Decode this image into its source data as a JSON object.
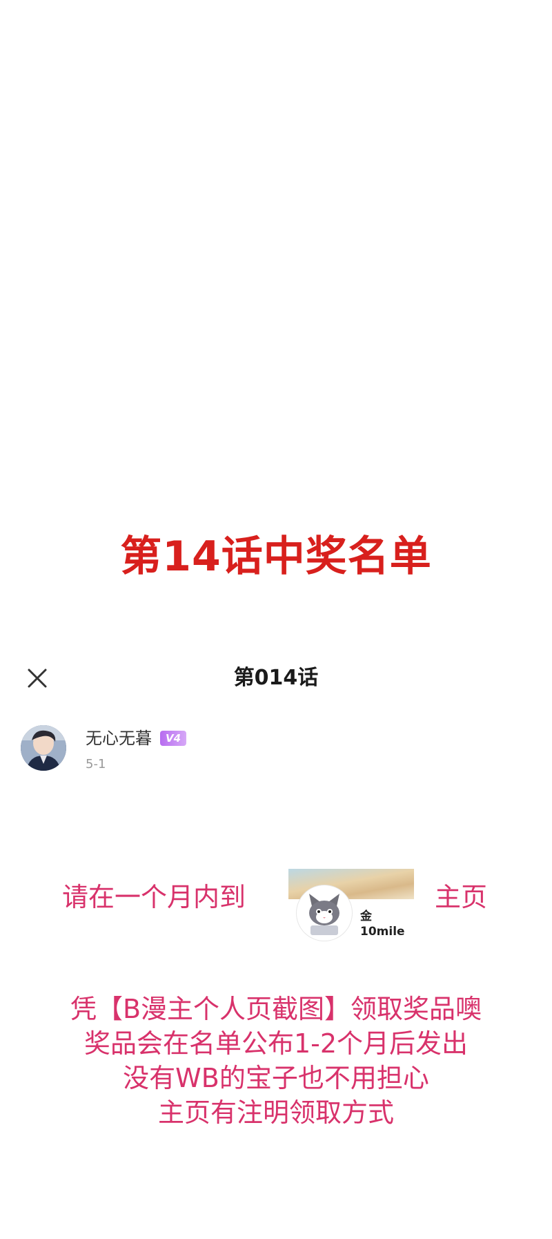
{
  "headline": "第14话中奖名单",
  "nav": {
    "title": "第014话",
    "close_icon": "close-icon"
  },
  "post": {
    "author": "无心无暮",
    "level_badge": "V4",
    "date": "5-1"
  },
  "message": {
    "left_text": "请在一个月内到",
    "right_text": "主页",
    "profile_name": "金10mile"
  },
  "instructions": [
    "凭【B漫主个人页截图】领取奖品噢",
    "奖品会在名单公布1-2个月后发出",
    "没有WB的宝子也不用担心",
    "主页有注明领取方式"
  ],
  "colors": {
    "headline": "#d8201d",
    "pink": "#d8326b",
    "badge": "#b76cf0"
  }
}
